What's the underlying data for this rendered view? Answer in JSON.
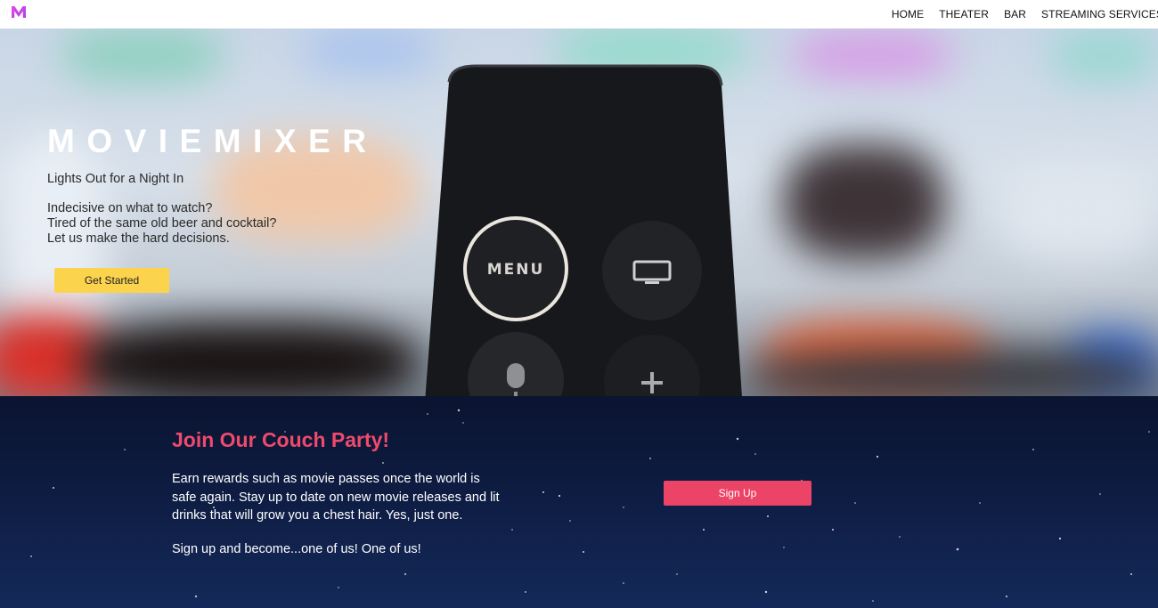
{
  "nav": {
    "logo_letter": "M",
    "links": [
      "HOME",
      "THEATER",
      "BAR",
      "STREAMING SERVICES"
    ]
  },
  "hero": {
    "title": "MOVIEMIXER",
    "tagline": "Lights Out for a Night In",
    "body_lines": [
      "Indecisive on what to watch?",
      "Tired of the same old beer and cocktail?",
      "Let us make the hard decisions."
    ],
    "cta_label": "Get Started",
    "remote_menu_label": "MENU"
  },
  "party": {
    "title": "Join Our Couch Party!",
    "body": "Earn rewards such as movie passes once the world is safe again. Stay up to date on new movie releases and lit drinks that will grow you a chest hair. Yes, just one.",
    "closing": "Sign up and become...one of us! One of us!",
    "signup_label": "Sign Up"
  },
  "colors": {
    "logo": "#c845e0",
    "cta_yellow": "#fcd34d",
    "accent_pink": "#ec4466",
    "party_bg": "#0e1d44"
  }
}
